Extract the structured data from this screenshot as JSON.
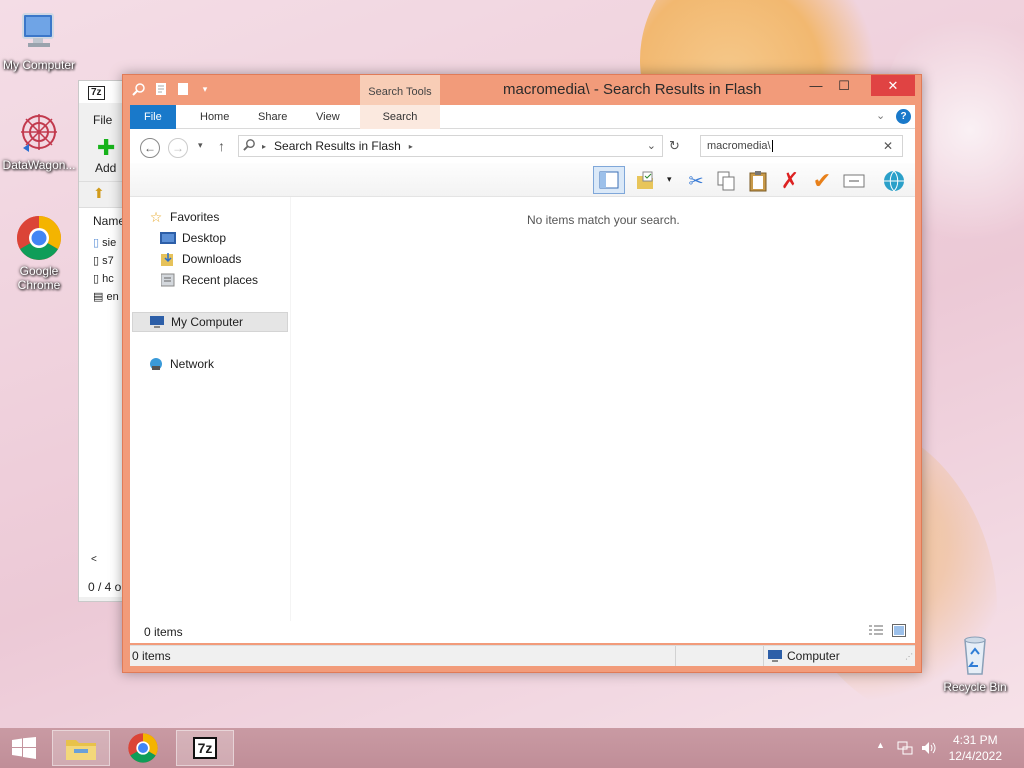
{
  "desktop": {
    "icons": [
      {
        "label": "My Computer",
        "icon": "monitor-icon"
      },
      {
        "label": "DataWagon...",
        "icon": "datawagon-icon"
      },
      {
        "label": "Google Chrome",
        "icon": "chrome-icon"
      },
      {
        "label": "Recycle Bin",
        "icon": "recycle-bin-icon"
      }
    ]
  },
  "back_window": {
    "app_badge": "7z",
    "menu_file": "File",
    "add_label": "Add",
    "column_header": "Name",
    "rows": [
      "sie",
      "s7",
      "hc",
      "en"
    ],
    "status": "0 / 4 o"
  },
  "explorer": {
    "title": "macromedia\\ - Search Results in Flash",
    "context_tab": "Search Tools",
    "window_controls": {
      "minimize": "—",
      "maximize": "☐",
      "close": "✕"
    },
    "ribbon_tabs": [
      "File",
      "Home",
      "Share",
      "View",
      "Search"
    ],
    "address": {
      "path": "Search Results in Flash"
    },
    "search": {
      "value": "macromedia\\"
    },
    "nav": {
      "favorites": "Favorites",
      "favorites_items": [
        "Desktop",
        "Downloads",
        "Recent places"
      ],
      "computer": "My Computer",
      "network": "Network"
    },
    "empty_message": "No items match your search.",
    "details_count": "0 items",
    "status": {
      "items": "0 items",
      "location": "Computer"
    }
  },
  "taskbar": {
    "apps": [
      "file-explorer-icon",
      "chrome-icon",
      "7zip-icon"
    ],
    "time": "4:31 PM",
    "date": "12/4/2022"
  },
  "colors": {
    "window_frame": "#f29b7a",
    "file_tab": "#1979ca",
    "close_button": "#e04343",
    "taskbar": "#c38f99"
  }
}
